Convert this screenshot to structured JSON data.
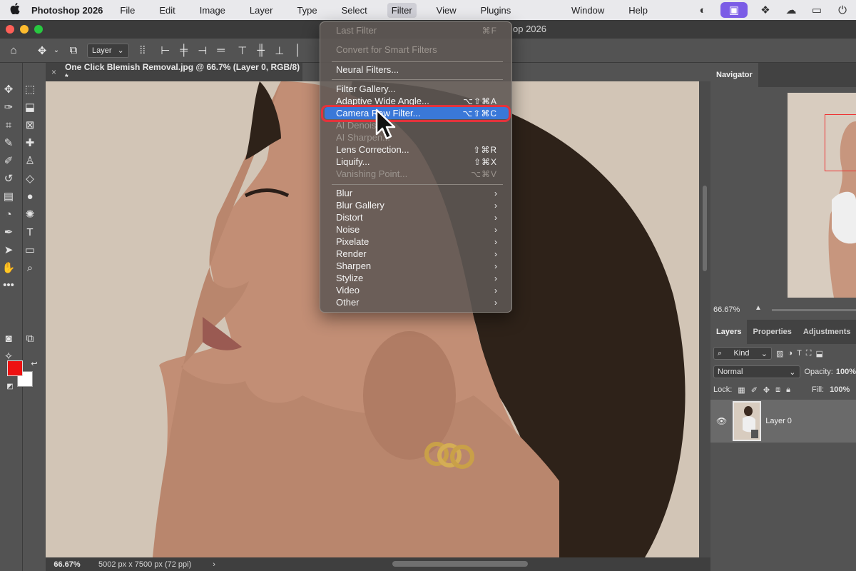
{
  "menubar": {
    "app_name": "Photoshop 2026",
    "menus": [
      "File",
      "Edit",
      "Image",
      "Layer",
      "Type",
      "Select",
      "Filter",
      "View",
      "Plugins"
    ],
    "right_menus": [
      "Window",
      "Help"
    ],
    "active_menu": "Filter"
  },
  "window": {
    "title": "op 2026"
  },
  "options_bar": {
    "layer_select": "Layer"
  },
  "document": {
    "tab_title": "One Click Blemish Removal.jpg @ 66.7% (Layer 0, RGB/8) *",
    "zoom": "66.67%",
    "dimensions": "5002 px x 7500 px (72 ppi)",
    "status_arrow": "›"
  },
  "filter_menu": {
    "items": [
      {
        "label": "Last Filter",
        "shortcut": "⌘F",
        "disabled": true
      },
      {
        "label": "Convert for Smart Filters",
        "shortcut": "",
        "disabled": true
      },
      {
        "label": "Neural Filters...",
        "shortcut": ""
      },
      {
        "label": "Filter Gallery...",
        "shortcut": ""
      },
      {
        "label": "Adaptive Wide Angle...",
        "shortcut": "⌥⇧⌘A"
      },
      {
        "label": "Camera Raw Filter...",
        "shortcut": "⌥⇧⌘C",
        "selected": true
      },
      {
        "label": "AI Denoise...",
        "shortcut": "",
        "disabled": true
      },
      {
        "label": "AI Sharpen...",
        "shortcut": "",
        "disabled": true
      },
      {
        "label": "Lens Correction...",
        "shortcut": "⇧⌘R"
      },
      {
        "label": "Liquify...",
        "shortcut": "⇧⌘X"
      },
      {
        "label": "Vanishing Point...",
        "shortcut": "⌥⌘V",
        "disabled": true
      },
      {
        "label": "Blur",
        "submenu": true
      },
      {
        "label": "Blur Gallery",
        "submenu": true
      },
      {
        "label": "Distort",
        "submenu": true
      },
      {
        "label": "Noise",
        "submenu": true
      },
      {
        "label": "Pixelate",
        "submenu": true
      },
      {
        "label": "Render",
        "submenu": true
      },
      {
        "label": "Sharpen",
        "submenu": true
      },
      {
        "label": "Stylize",
        "submenu": true
      },
      {
        "label": "Video",
        "submenu": true
      },
      {
        "label": "Other",
        "submenu": true
      }
    ]
  },
  "navigator": {
    "tab": "Navigator",
    "zoom": "66.67%"
  },
  "layers_panel": {
    "tabs": [
      "Layers",
      "Properties",
      "Adjustments"
    ],
    "filter_kind": "Kind",
    "blend_mode": "Normal",
    "opacity_label": "Opacity:",
    "opacity": "100%",
    "lock_label": "Lock:",
    "fill_label": "Fill:",
    "fill": "100%",
    "layer_name": "Layer 0"
  },
  "colors": {
    "foreground": "#ee1111",
    "background": "#ffffff",
    "highlight": "#3a78d8",
    "callout": "#e2333c"
  }
}
